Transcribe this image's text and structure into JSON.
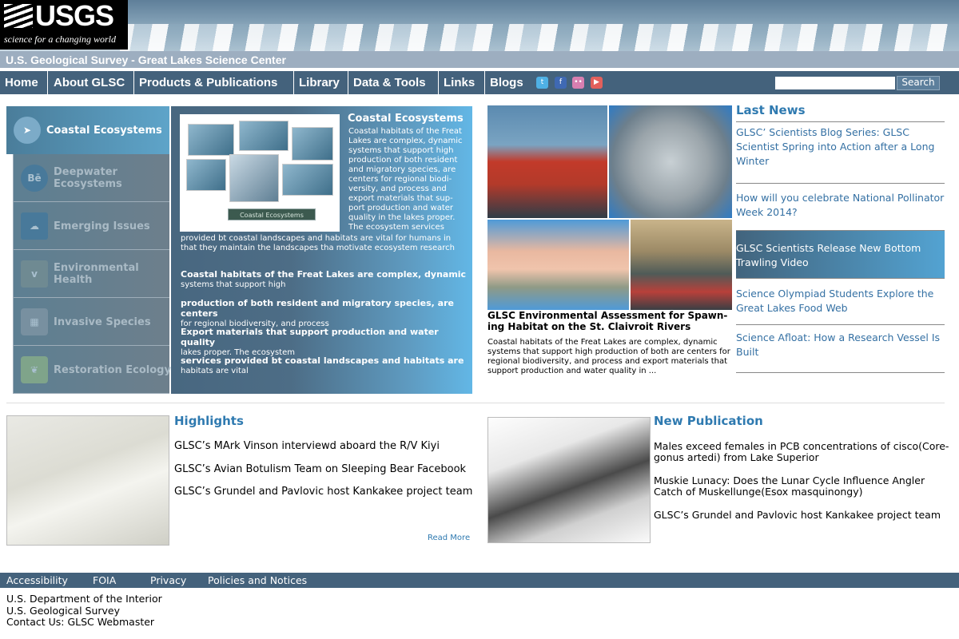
{
  "header": {
    "logo_text": "USGS",
    "tagline": "science for a changing world",
    "site_title": "U.S. Geological Survey - Great Lakes Science Center"
  },
  "nav": {
    "items": [
      "Home",
      "About GLSC",
      "Products & Publications",
      "Library",
      "Data & Tools",
      "Links",
      "Blogs"
    ],
    "social_icons": [
      "twitter-icon",
      "facebook-icon",
      "flickr-icon",
      "youtube-icon"
    ],
    "search_button": "Search",
    "search_value": ""
  },
  "sidebar": {
    "items": [
      {
        "label": "Coastal Ecosystems",
        "icon": "cursor-icon"
      },
      {
        "label": "Deepwater Ecosystems",
        "icon": "behance-icon"
      },
      {
        "label": "Emerging Issues",
        "icon": "cloud-icon"
      },
      {
        "label": "Environmental Health",
        "icon": "vimeo-icon"
      },
      {
        "label": "Invasive Species",
        "icon": "grid-icon"
      },
      {
        "label": "Restoration Ecology",
        "icon": "leaf-icon"
      }
    ]
  },
  "feature": {
    "image_caption": "Coastal Ecosystems",
    "title": "Coastal Ecosystems",
    "text": "Coastal habitats of the Freat Lakes are complex, dynamic systems that support high production of both resident and migratory species, are centers for regional biodi-versity, and process and export materials that sup-port production and water quality in the lakes proper. The ecosystem services",
    "text_continued": "provided bt coastal landscapes and habitats are vital for humans in that they maintain the landscapes tha motivate ecosystem research",
    "paragraphs": [
      {
        "bold": "Coastal habitats of the Freat Lakes are complex, dynamic",
        "normal": "systems that support high"
      },
      {
        "bold": "production of both resident and migratory species, are centers",
        "normal": "for regional biodiversity, and process"
      },
      {
        "bold": "Export materials that support production and water quality",
        "normal": "lakes proper. The ecosystem"
      },
      {
        "bold": "services provided bt coastal landscapes and habitats are",
        "normal": "habitats are vital"
      }
    ]
  },
  "news_story": {
    "caption": "GLSC Environmental Assessment for Spawn-ing Habitat on the St. Claivroit Rivers",
    "text": "Coastal habitats of the Freat Lakes are complex, dynamic systems that support high production of both are centers for regional biodiversity, and process and export materials that support production and water quality in ..."
  },
  "last_news": {
    "title": "Last News",
    "items": [
      "GLSC’ Scientists Blog Series: GLSC Scientist Spring into Action after a Long Winter",
      "How will you celebrate National Pollinator Week 2014?",
      "GLSC Scientists Release New Bottom Trawling Video",
      "Science Olympiad Students Explore the Great Lakes Food Web",
      "Science Afloat: How a Research Vessel Is Built"
    ]
  },
  "highlights": {
    "title": "Highlights",
    "items": [
      "GLSC’s MArk Vinson interviewd aboard the R/V Kiyi",
      "GLSC’s Avian Botulism Team on Sleeping Bear Facebook",
      "GLSC’s Grundel and Pavlovic host Kankakee project team"
    ],
    "read_more": "Read More"
  },
  "publication": {
    "title": "New Publication",
    "items": [
      "Males exceed females in PCB concentrations of cisco(Core-gonus artedi) from Lake Superior",
      "Muskie Lunacy: Does the Lunar Cycle Influence Angler Catch of Muskellunge(Esox masquinongy)",
      "GLSC’s Grundel and Pavlovic host Kankakee project team"
    ]
  },
  "footer": {
    "links": [
      "Accessibility",
      "FOIA",
      "Privacy",
      "Policies and Notices"
    ],
    "lines": [
      "U.S. Department of the Interior",
      "U.S. Geological Survey",
      "Contact Us: GLSC Webmaster"
    ]
  },
  "colors": {
    "nav_bg": "#44627c",
    "accent_blue": "#2f7ab0",
    "title_bar": "#9daec0"
  }
}
